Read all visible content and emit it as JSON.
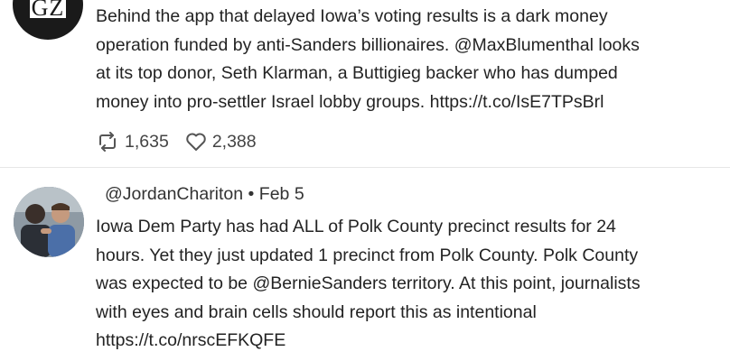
{
  "tweets": [
    {
      "avatar_text": "GZ",
      "text": "Behind the app that delayed Iowa’s voting results is a dark money\noperation funded by anti-Sanders billionaires. @MaxBlumenthal looks\nat its top donor, Seth Klarman, a Buttigieg backer who has dumped\nmoney into pro-settler Israel lobby groups. https://t.co/IsE7TPsBrl",
      "retweets": "1,635",
      "likes": "2,388",
      "icons": [
        "retweet-icon",
        "heart-icon"
      ]
    },
    {
      "handle": "@JordanChariton",
      "separator": "•",
      "date": "Feb 5",
      "text": "Iowa Dem Party has had ALL of Polk County precinct results for 24\nhours. Yet they just updated 1 precinct from Polk County. Polk County\nwas expected to be @BernieSanders territory. At this point, journalists\nwith eyes and brain cells should report this as intentional\nhttps://t.co/nrscEFKQFE"
    }
  ],
  "colors": {
    "text": "#232323",
    "divider": "#e6e6e6",
    "icon": "#555555"
  }
}
